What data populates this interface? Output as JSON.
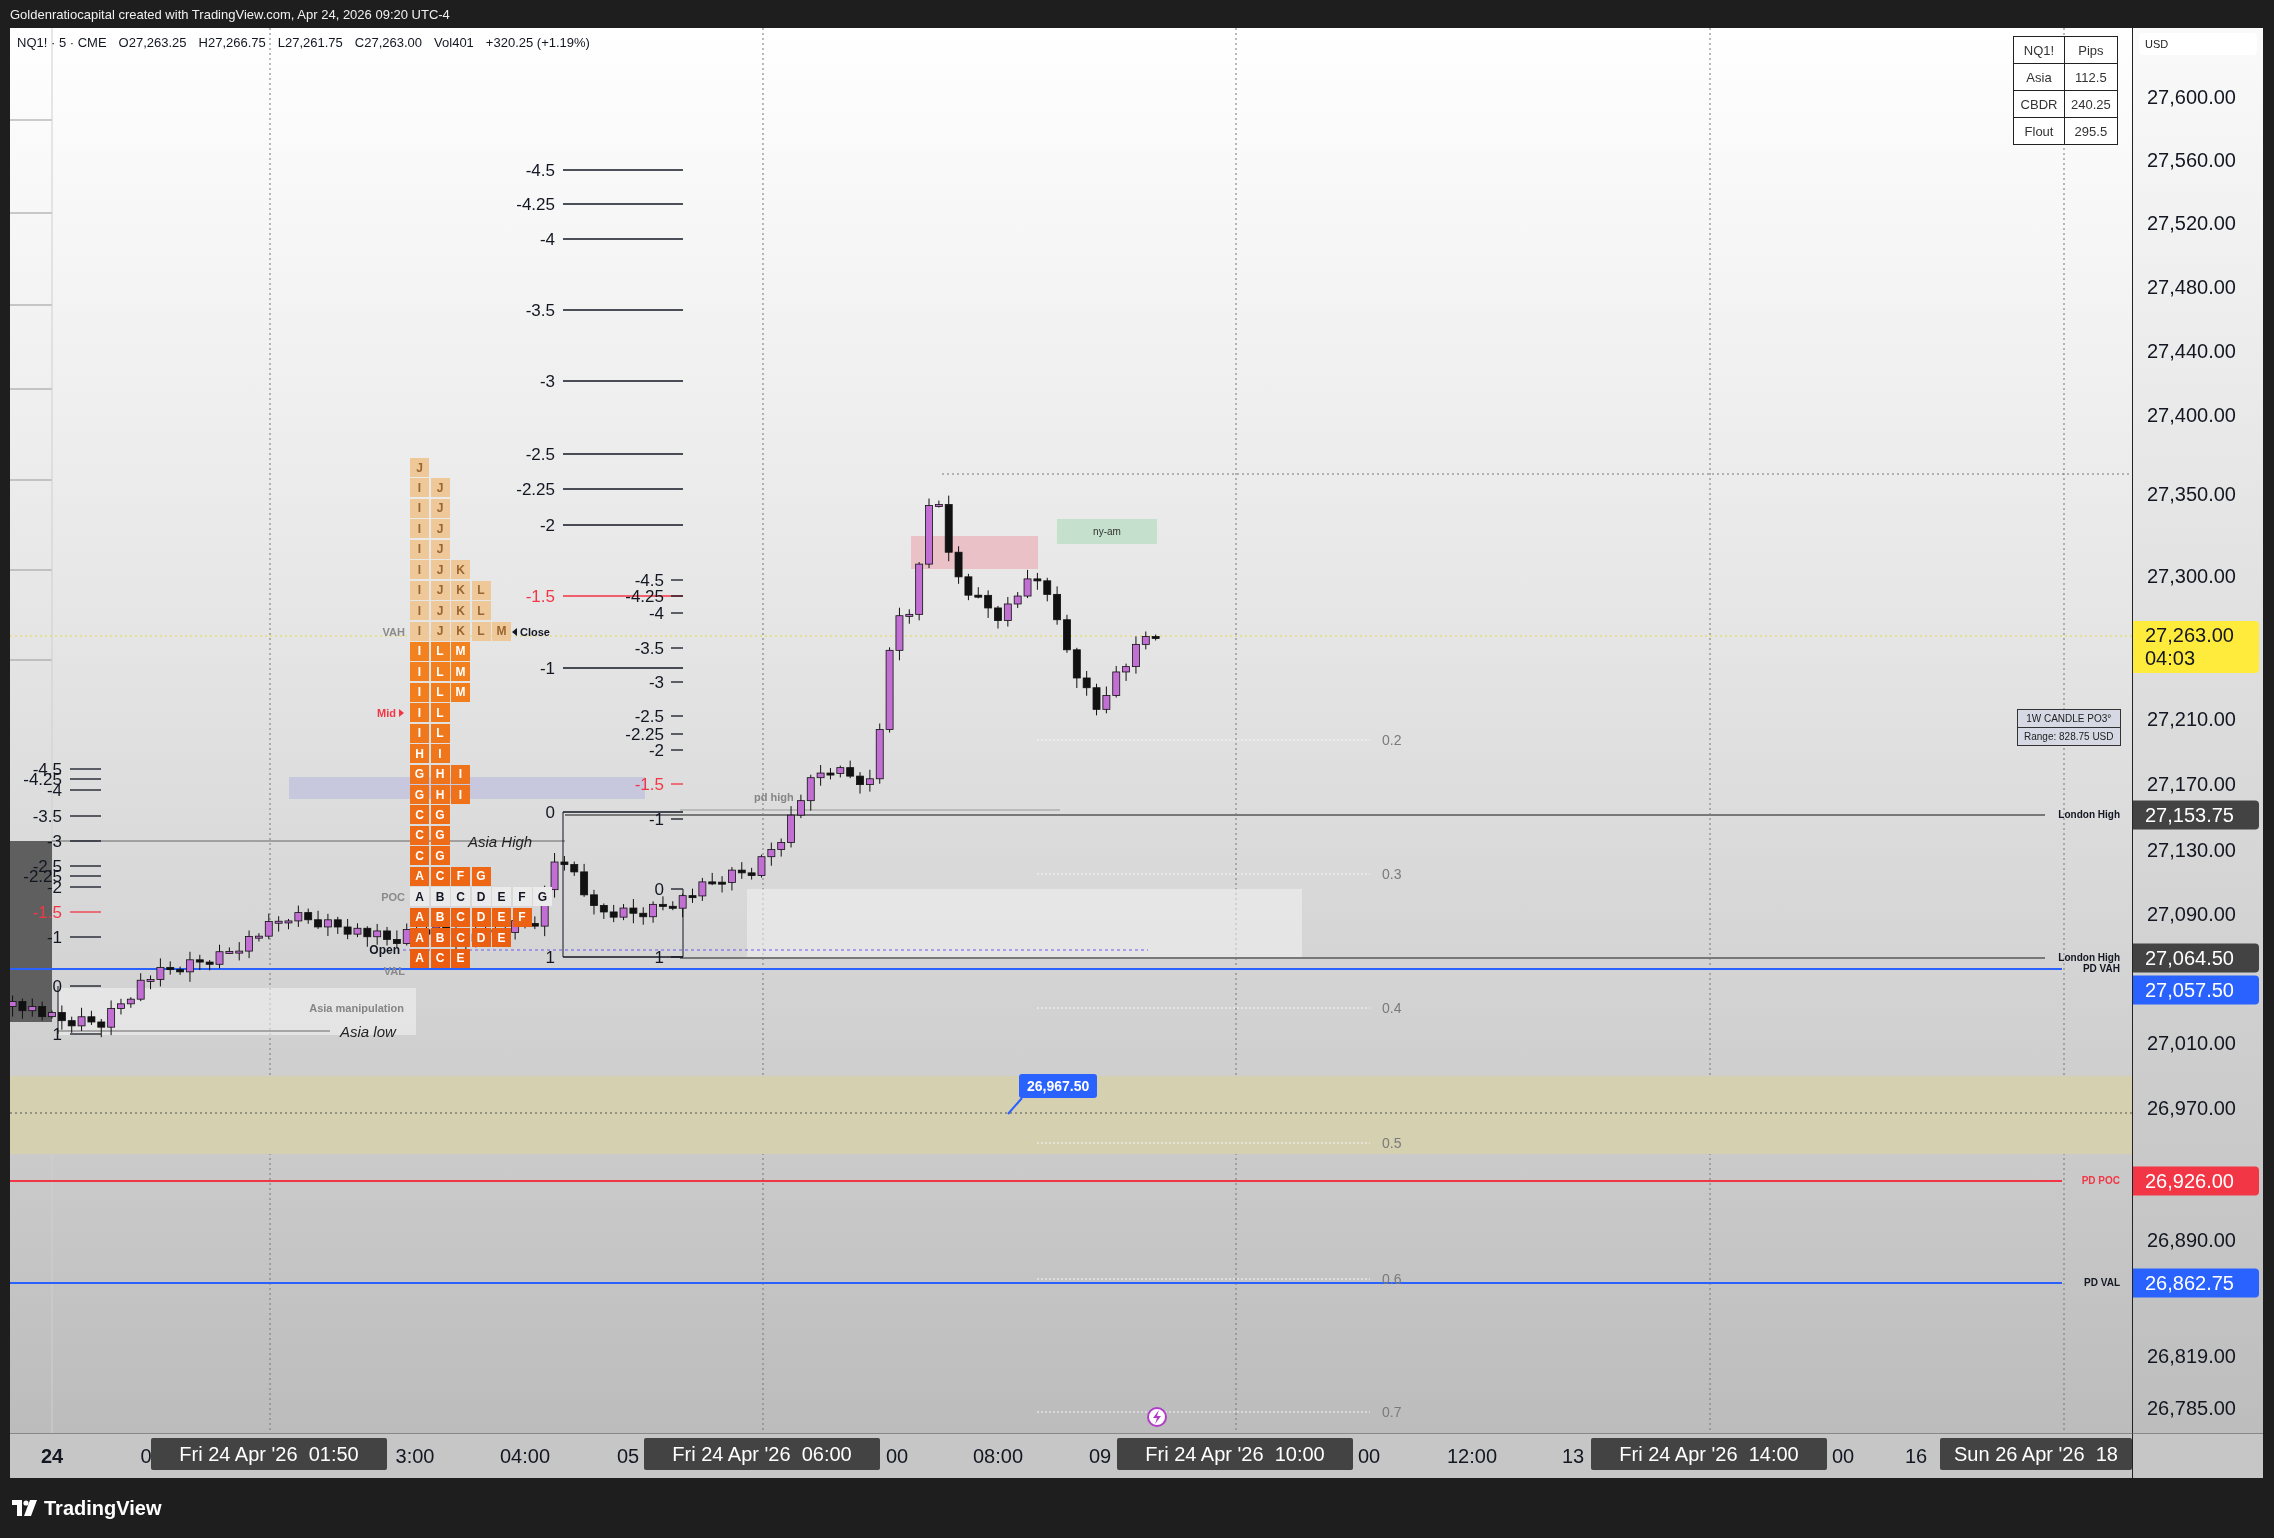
{
  "header": {
    "credit": "Goldenratiocapital created with TradingView.com, Apr 24, 2026 09:20 UTC-4"
  },
  "legend": {
    "symbol": "NQ1! · 5 · CME",
    "values": [
      "O27,263.25",
      "H27,266.75",
      "L27,261.75",
      "C27,263.00",
      "Vol401",
      "+320.25 (+1.19%)"
    ]
  },
  "stats_table": {
    "columns": [
      "NQ1!",
      "Pips"
    ],
    "rows": [
      {
        "session": "Asia",
        "pips": "112.5"
      },
      {
        "session": "CBDR",
        "pips": "240.25"
      },
      {
        "session": "Flout",
        "pips": "295.5"
      }
    ]
  },
  "candle_info": {
    "title": "1W CANDLE PO3°",
    "range": "Range: 828.75 USD"
  },
  "fib_sets": [
    {
      "levels": [
        {
          "label": "-4.5",
          "highlight": false
        },
        {
          "label": "-4.25",
          "highlight": false
        },
        {
          "label": "-4",
          "highlight": false
        },
        {
          "label": "-3.5",
          "highlight": false
        },
        {
          "label": "-3",
          "highlight": false
        },
        {
          "label": "-2.5",
          "highlight": false
        },
        {
          "label": "-2.25",
          "highlight": false
        },
        {
          "label": "-2",
          "highlight": false
        },
        {
          "label": "-1.5",
          "highlight": true
        },
        {
          "label": "-1",
          "highlight": false
        },
        {
          "label": "0",
          "highlight": false
        },
        {
          "label": "1",
          "highlight": false
        }
      ]
    },
    {
      "levels": [
        {
          "label": "-4.5",
          "highlight": false
        },
        {
          "label": "-4.25",
          "highlight": false
        },
        {
          "label": "-4",
          "highlight": false
        },
        {
          "label": "-3.5",
          "highlight": false
        },
        {
          "label": "-3",
          "highlight": false
        },
        {
          "label": "-2.5",
          "highlight": false
        },
        {
          "label": "-2.25",
          "highlight": false
        },
        {
          "label": "-2",
          "highlight": false
        },
        {
          "label": "-1.5",
          "highlight": true
        },
        {
          "label": "-1",
          "highlight": false
        },
        {
          "label": "0",
          "highlight": false
        },
        {
          "label": "1",
          "highlight": false
        }
      ]
    },
    {
      "levels": [
        {
          "label": "-4.5",
          "highlight": false
        },
        {
          "label": "-4.25",
          "highlight": false
        },
        {
          "label": "-4",
          "highlight": false
        },
        {
          "label": "-3.5",
          "highlight": false
        },
        {
          "label": "-3",
          "highlight": false
        },
        {
          "label": "-2.5",
          "highlight": false
        },
        {
          "label": "-2.25",
          "highlight": false
        },
        {
          "label": "-2",
          "highlight": false
        },
        {
          "label": "-1.5",
          "highlight": true
        },
        {
          "label": "-1",
          "highlight": false
        },
        {
          "label": "0",
          "highlight": false
        },
        {
          "label": "1",
          "highlight": false
        }
      ]
    }
  ],
  "tpo_profile": {
    "rows": [
      {
        "letters": [
          "J"
        ],
        "kind": "outside"
      },
      {
        "letters": [
          "I",
          "J"
        ],
        "kind": "outside"
      },
      {
        "letters": [
          "I",
          "J"
        ],
        "kind": "outside"
      },
      {
        "letters": [
          "I",
          "J"
        ],
        "kind": "outside"
      },
      {
        "letters": [
          "I",
          "J"
        ],
        "kind": "outside"
      },
      {
        "letters": [
          "I",
          "J",
          "K"
        ],
        "kind": "outside"
      },
      {
        "letters": [
          "I",
          "J",
          "K",
          "L"
        ],
        "kind": "outside"
      },
      {
        "letters": [
          "I",
          "J",
          "K",
          "L"
        ],
        "kind": "outside"
      },
      {
        "letters": [
          "I",
          "J",
          "K",
          "L",
          "M"
        ],
        "kind": "outside"
      },
      {
        "letters": [
          "I",
          "L",
          "M"
        ],
        "kind": "value"
      },
      {
        "letters": [
          "I",
          "L",
          "M"
        ],
        "kind": "value"
      },
      {
        "letters": [
          "I",
          "L",
          "M"
        ],
        "kind": "value"
      },
      {
        "letters": [
          "I",
          "L"
        ],
        "kind": "value"
      },
      {
        "letters": [
          "I",
          "L"
        ],
        "kind": "value"
      },
      {
        "letters": [
          "H",
          "I"
        ],
        "kind": "value"
      },
      {
        "letters": [
          "G",
          "H",
          "I"
        ],
        "kind": "value"
      },
      {
        "letters": [
          "G",
          "H",
          "I"
        ],
        "kind": "value"
      },
      {
        "letters": [
          "C",
          "G"
        ],
        "kind": "value"
      },
      {
        "letters": [
          "C",
          "G"
        ],
        "kind": "value"
      },
      {
        "letters": [
          "C",
          "G"
        ],
        "kind": "value"
      },
      {
        "letters": [
          "A",
          "C",
          "F",
          "G"
        ],
        "kind": "value"
      },
      {
        "letters": [
          "A",
          "B",
          "C",
          "D",
          "E",
          "F",
          "G"
        ],
        "kind": "poc"
      },
      {
        "letters": [
          "A",
          "B",
          "C",
          "D",
          "E",
          "F"
        ],
        "kind": "value"
      },
      {
        "letters": [
          "A",
          "B",
          "C",
          "D",
          "E"
        ],
        "kind": "value"
      },
      {
        "letters": [
          "A",
          "C",
          "E"
        ],
        "kind": "value"
      }
    ],
    "markers": [
      {
        "label": "VAH",
        "kind": "faint"
      },
      {
        "label": "Close",
        "kind": "close"
      },
      {
        "label": "Mid",
        "kind": "mid"
      },
      {
        "label": "POC",
        "kind": "faint"
      },
      {
        "label": "Open",
        "kind": "open"
      },
      {
        "label": "VAL",
        "kind": "faint"
      }
    ]
  },
  "session_labels": [
    {
      "label": "Asia High",
      "kind": "italic"
    },
    {
      "label": "Asia manipulation",
      "kind": "faint"
    },
    {
      "label": "Asia low",
      "kind": "italic"
    },
    {
      "label": "pd high",
      "kind": "faint"
    },
    {
      "label": "ny-am",
      "kind": "tag"
    }
  ],
  "retracement": {
    "levels": [
      "0.2",
      "0.3",
      "0.4",
      "0.5",
      "0.6",
      "0.7"
    ]
  },
  "level_lines": [
    {
      "label": "London High",
      "color": "#787878"
    },
    {
      "label": "London High",
      "color": "#787878"
    },
    {
      "label": "PD VAH",
      "color": "#2962ff"
    },
    {
      "label": "PD POC",
      "color": "#f23645"
    },
    {
      "label": "PD VAL",
      "color": "#2962ff"
    }
  ],
  "price_callout": "26,967.50",
  "price_axis": {
    "currency": "USD",
    "ticks": [
      "27,600.00",
      "27,560.00",
      "27,520.00",
      "27,480.00",
      "27,440.00",
      "27,400.00",
      "27,350.00",
      "27,300.00",
      "27,210.00",
      "27,170.00",
      "27,130.00",
      "27,090.00",
      "27,010.00",
      "26,970.00",
      "26,890.00",
      "26,819.00",
      "26,785.00"
    ],
    "badges": [
      {
        "price": "27,263.00",
        "countdown": "04:03",
        "color": "#ffeb3b"
      },
      {
        "price": "27,153.75",
        "color": "#434343"
      },
      {
        "price": "27,064.50",
        "color": "#434343"
      },
      {
        "price": "27,057.50",
        "color": "#2962ff"
      },
      {
        "price": "26,926.00",
        "color": "#f23645"
      },
      {
        "price": "26,862.75",
        "color": "#2962ff"
      }
    ]
  },
  "time_axis": {
    "ticks": [
      {
        "label": "24",
        "kind": "day"
      },
      {
        "label": "0",
        "kind": "time"
      },
      {
        "label": "3:00",
        "kind": "time"
      },
      {
        "label": "04:00",
        "kind": "time"
      },
      {
        "label": "05",
        "kind": "time"
      },
      {
        "label": "00",
        "kind": "time"
      },
      {
        "label": "08:00",
        "kind": "time"
      },
      {
        "label": "09",
        "kind": "time"
      },
      {
        "label": "00",
        "kind": "time"
      },
      {
        "label": "12:00",
        "kind": "time"
      },
      {
        "label": "13",
        "kind": "time"
      },
      {
        "label": "00",
        "kind": "time"
      },
      {
        "label": "16",
        "kind": "time"
      }
    ],
    "cursor_labels": [
      "Fri 24 Apr '26  01:50",
      "Fri 24 Apr '26  06:00",
      "Fri 24 Apr '26  10:00",
      "Fri 24 Apr '26  14:00",
      "Sun 26 Apr '26  18"
    ]
  },
  "footer": {
    "brand": "TradingView"
  }
}
